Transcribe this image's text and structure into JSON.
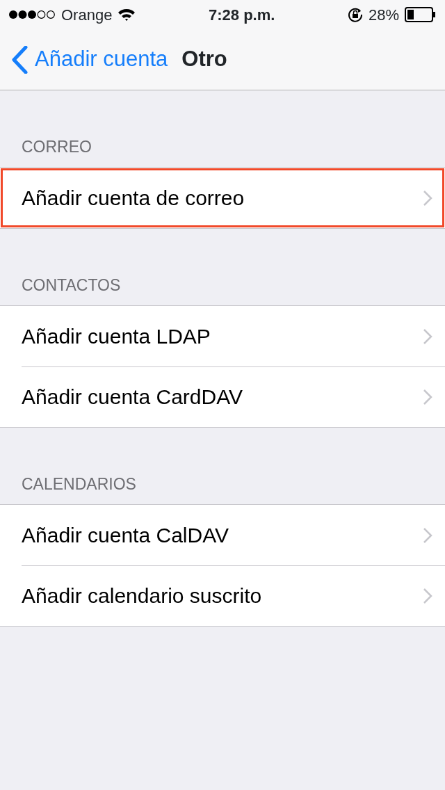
{
  "status_bar": {
    "carrier": "Orange",
    "time": "7:28 p.m.",
    "battery_percent": "28%"
  },
  "nav_bar": {
    "back_label": "Añadir cuenta",
    "title": "Otro"
  },
  "sections": [
    {
      "header": "CORREO",
      "rows": [
        {
          "label": "Añadir cuenta de correo",
          "highlighted": true
        }
      ]
    },
    {
      "header": "CONTACTOS",
      "rows": [
        {
          "label": "Añadir cuenta LDAP",
          "highlighted": false
        },
        {
          "label": "Añadir cuenta CardDAV",
          "highlighted": false
        }
      ]
    },
    {
      "header": "CALENDARIOS",
      "rows": [
        {
          "label": "Añadir cuenta CalDAV",
          "highlighted": false
        },
        {
          "label": "Añadir calendario suscrito",
          "highlighted": false
        }
      ]
    }
  ]
}
